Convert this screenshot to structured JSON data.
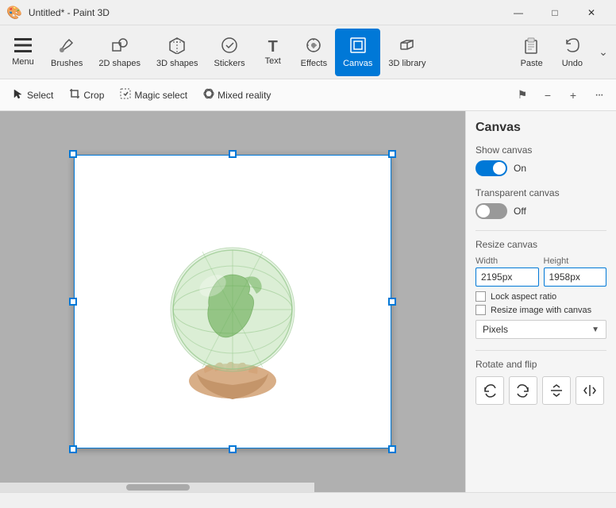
{
  "app": {
    "title": "Untitled* - Paint 3D",
    "titlebar_icon": "🎨"
  },
  "titlebar": {
    "title": "Untitled* - Paint 3D",
    "minimize": "—",
    "maximize": "□",
    "close": "✕"
  },
  "toolbar": {
    "items": [
      {
        "id": "menu",
        "icon": "☰",
        "label": "Menu"
      },
      {
        "id": "brushes",
        "icon": "🖌",
        "label": "Brushes"
      },
      {
        "id": "2d-shapes",
        "icon": "⬡",
        "label": "2D shapes"
      },
      {
        "id": "3d-shapes",
        "icon": "⬡",
        "label": "3D shapes"
      },
      {
        "id": "stickers",
        "icon": "⊕",
        "label": "Stickers"
      },
      {
        "id": "text",
        "icon": "T",
        "label": "Text"
      },
      {
        "id": "effects",
        "icon": "✦",
        "label": "Effects"
      },
      {
        "id": "canvas",
        "icon": "⧉",
        "label": "Canvas"
      },
      {
        "id": "3d-library",
        "icon": "⬡",
        "label": "3D library"
      }
    ],
    "right_items": [
      {
        "id": "paste",
        "icon": "📋",
        "label": "Paste"
      },
      {
        "id": "undo",
        "icon": "↩",
        "label": "Undo"
      },
      {
        "id": "more",
        "icon": "⌄",
        "label": ""
      }
    ],
    "active_item": "canvas"
  },
  "secondary_toolbar": {
    "tools": [
      {
        "id": "select",
        "icon": "↖",
        "label": "Select"
      },
      {
        "id": "crop",
        "icon": "⊡",
        "label": "Crop"
      },
      {
        "id": "magic-select",
        "icon": "⊡",
        "label": "Magic select"
      },
      {
        "id": "mixed-reality",
        "icon": "⊡",
        "label": "Mixed reality"
      }
    ],
    "right_buttons": [
      {
        "id": "flag",
        "icon": "⚑"
      },
      {
        "id": "minus",
        "icon": "−"
      },
      {
        "id": "plus",
        "icon": "+"
      },
      {
        "id": "more",
        "icon": "···"
      }
    ]
  },
  "canvas_panel": {
    "title": "Canvas",
    "show_canvas": {
      "label": "Show canvas",
      "state": "on",
      "text": "On"
    },
    "transparent_canvas": {
      "label": "Transparent canvas",
      "state": "off",
      "text": "Off"
    },
    "resize_canvas": {
      "label": "Resize canvas",
      "width_label": "Width",
      "height_label": "Height",
      "width_value": "2195px",
      "height_value": "1958px",
      "lock_aspect": "Lock aspect ratio",
      "resize_image": "Resize image with canvas",
      "unit": "Pixels"
    },
    "rotate_flip": {
      "label": "Rotate and flip",
      "buttons": [
        {
          "id": "rotate-left",
          "icon": "↺"
        },
        {
          "id": "rotate-right",
          "icon": "↻"
        },
        {
          "id": "flip-vertical",
          "icon": "⇅"
        },
        {
          "id": "flip-horizontal",
          "icon": "⇄"
        }
      ]
    }
  }
}
